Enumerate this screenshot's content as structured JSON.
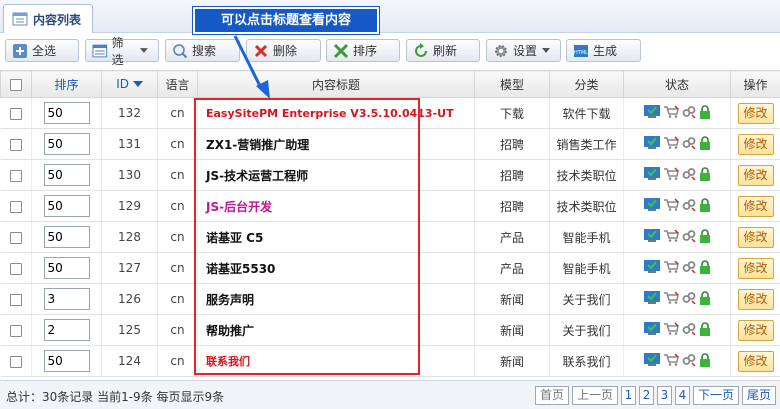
{
  "header": {
    "tab_label": "内容列表"
  },
  "annotation": {
    "text": "可以点击标题查看内容"
  },
  "toolbar": {
    "select_all": "全选",
    "filter": "筛选",
    "search": "搜索",
    "delete": "删除",
    "sort": "排序",
    "refresh": "刷新",
    "settings": "设置",
    "generate": "生成"
  },
  "table": {
    "headers": {
      "order": "排序",
      "id": "ID",
      "lang": "语言",
      "title": "内容标题",
      "model": "模型",
      "category": "分类",
      "status": "状态",
      "action": "操作"
    },
    "rows": [
      {
        "order": "50",
        "id": "132",
        "lang": "cn",
        "title": "EasySitePM Enterprise V3.5.10.0413-UT",
        "model": "下载",
        "category": "软件下载",
        "edit": "修改"
      },
      {
        "order": "50",
        "id": "131",
        "lang": "cn",
        "title": "ZX1-营销推广助理",
        "model": "招聘",
        "category": "销售类工作",
        "edit": "修改"
      },
      {
        "order": "50",
        "id": "130",
        "lang": "cn",
        "title": "JS-技术运营工程师",
        "model": "招聘",
        "category": "技术类职位",
        "edit": "修改"
      },
      {
        "order": "50",
        "id": "129",
        "lang": "cn",
        "title": "JS-后台开发",
        "model": "招聘",
        "category": "技术类职位",
        "edit": "修改"
      },
      {
        "order": "50",
        "id": "128",
        "lang": "cn",
        "title": "诺基亚 C5",
        "model": "产品",
        "category": "智能手机",
        "edit": "修改"
      },
      {
        "order": "50",
        "id": "127",
        "lang": "cn",
        "title": "诺基亚5530",
        "model": "产品",
        "category": "智能手机",
        "edit": "修改"
      },
      {
        "order": "3",
        "id": "126",
        "lang": "cn",
        "title": "服务声明",
        "model": "新闻",
        "category": "关于我们",
        "edit": "修改"
      },
      {
        "order": "2",
        "id": "125",
        "lang": "cn",
        "title": "帮助推广",
        "model": "新闻",
        "category": "关于我们",
        "edit": "修改"
      },
      {
        "order": "50",
        "id": "124",
        "lang": "cn",
        "title": "联系我们",
        "model": "新闻",
        "category": "联系我们",
        "edit": "修改"
      }
    ]
  },
  "footer": {
    "total": "总计：30条记录 当前1-9条 每页显示9条",
    "first": "首页",
    "prev": "上一页",
    "pages": [
      "1",
      "2",
      "3",
      "4"
    ],
    "next": "下一页",
    "last": "尾页"
  },
  "colors": {
    "accent": "#1459c6",
    "highlight_box": "#e1232b",
    "title_red": "#d9131f",
    "title_pink": "#c2188c"
  }
}
